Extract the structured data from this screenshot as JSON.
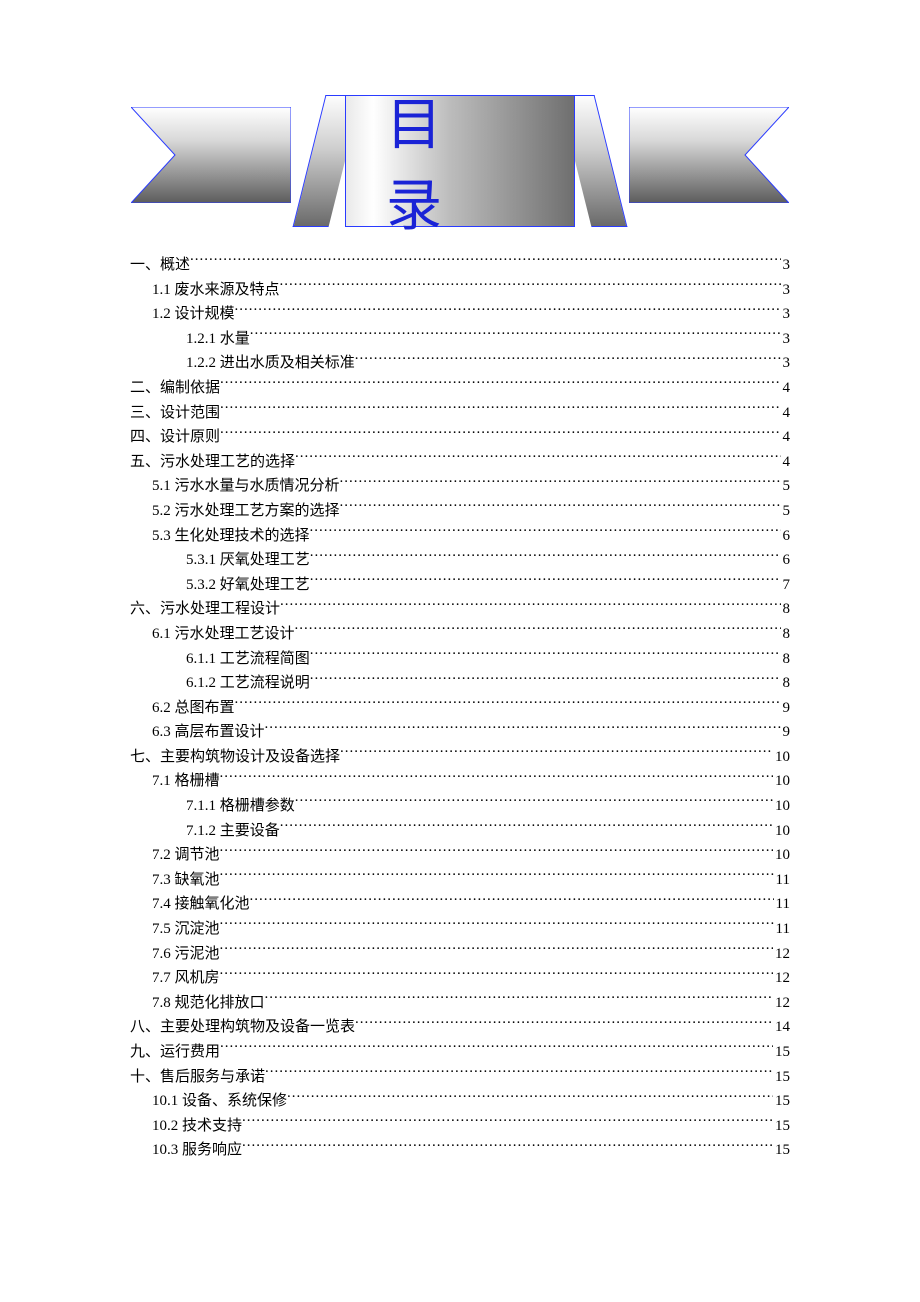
{
  "banner": {
    "title": "目录"
  },
  "toc": [
    {
      "level": 0,
      "title": "一、概述",
      "page": "3"
    },
    {
      "level": 1,
      "title": "1.1 废水来源及特点",
      "page": "3"
    },
    {
      "level": 1,
      "title": "1.2 设计规模",
      "page": "3"
    },
    {
      "level": 2,
      "title": "1.2.1 水量",
      "page": "3"
    },
    {
      "level": 2,
      "title": "1.2.2 进出水质及相关标准",
      "page": "3"
    },
    {
      "level": 0,
      "title": "二、编制依据",
      "page": "4"
    },
    {
      "level": 0,
      "title": "三、设计范围",
      "page": "4"
    },
    {
      "level": 0,
      "title": "四、设计原则",
      "page": "4"
    },
    {
      "level": 0,
      "title": "五、污水处理工艺的选择",
      "page": "4"
    },
    {
      "level": 1,
      "title": "5.1 污水水量与水质情况分析",
      "page": "5"
    },
    {
      "level": 1,
      "title": "5.2 污水处理工艺方案的选择",
      "page": "5"
    },
    {
      "level": 1,
      "title": "5.3 生化处理技术的选择",
      "page": "6"
    },
    {
      "level": 2,
      "title": "5.3.1 厌氧处理工艺",
      "page": "6"
    },
    {
      "level": 2,
      "title": "5.3.2 好氧处理工艺",
      "page": "7"
    },
    {
      "level": 0,
      "title": "六、污水处理工程设计",
      "page": "8"
    },
    {
      "level": 1,
      "title": "6.1  污水处理工艺设计",
      "page": "8"
    },
    {
      "level": 2,
      "title": "6.1.1 工艺流程简图",
      "page": "8"
    },
    {
      "level": 2,
      "title": "6.1.2 工艺流程说明",
      "page": "8"
    },
    {
      "level": 1,
      "title": "6.2  总图布置",
      "page": "9"
    },
    {
      "level": 1,
      "title": "6.3  高层布置设计",
      "page": "9"
    },
    {
      "level": 0,
      "title": "七、主要构筑物设计及设备选择",
      "page": "10"
    },
    {
      "level": 1,
      "title": "7.1  格栅槽",
      "page": "10"
    },
    {
      "level": 2,
      "title": "7.1.1 格栅槽参数",
      "page": "10"
    },
    {
      "level": 2,
      "title": "7.1.2 主要设备",
      "page": "10"
    },
    {
      "level": 1,
      "title": "7.2 调节池",
      "page": "10"
    },
    {
      "level": 1,
      "title": "7.3 缺氧池",
      "page": "11"
    },
    {
      "level": 1,
      "title": "7.4 接触氧化池",
      "page": "11"
    },
    {
      "level": 1,
      "title": "7.5 沉淀池",
      "page": "11"
    },
    {
      "level": 1,
      "title": "7.6 污泥池",
      "page": "12"
    },
    {
      "level": 1,
      "title": "7.7 风机房",
      "page": "12"
    },
    {
      "level": 1,
      "title": "7.8 规范化排放口",
      "page": "12"
    },
    {
      "level": 0,
      "title": "八、主要处理构筑物及设备一览表",
      "page": "14"
    },
    {
      "level": 0,
      "title": "九、运行费用",
      "page": "15"
    },
    {
      "level": 0,
      "title": "十、售后服务与承诺",
      "page": "15"
    },
    {
      "level": 1,
      "title": "10.1 设备、系统保修",
      "page": "15"
    },
    {
      "level": 1,
      "title": "10.2 技术支持",
      "page": "15"
    },
    {
      "level": 1,
      "title": "10.3 服务响应",
      "page": "15"
    }
  ]
}
